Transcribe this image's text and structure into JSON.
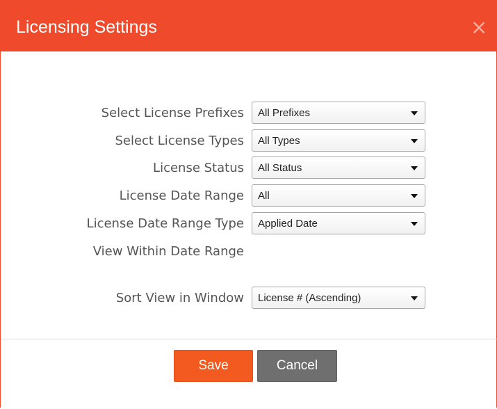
{
  "dialog": {
    "title": "Licensing Settings",
    "close_icon": "close-icon",
    "close_glyph": "×"
  },
  "fields": [
    {
      "label": "Select License Prefixes",
      "value": "All Prefixes",
      "icon": "chevron-down-icon"
    },
    {
      "label": "Select License Types",
      "value": "All Types",
      "icon": "chevron-down-icon"
    },
    {
      "label": "License Status",
      "value": "All Status",
      "icon": "chevron-down-icon"
    },
    {
      "label": "License Date Range",
      "value": "All",
      "icon": "chevron-down-icon"
    },
    {
      "label": "License Date Range Type",
      "value": "Applied Date",
      "icon": "chevron-down-icon"
    },
    {
      "label": "View Within Date Range"
    },
    {
      "label": "Sort View in Window",
      "value": "License # (Ascending)",
      "icon": "chevron-down-icon"
    }
  ],
  "actions": {
    "save": "Save",
    "cancel": "Cancel"
  },
  "colors": {
    "header": "#ef4a2b",
    "save": "#f35a1f",
    "cancel": "#6f6f6f"
  }
}
